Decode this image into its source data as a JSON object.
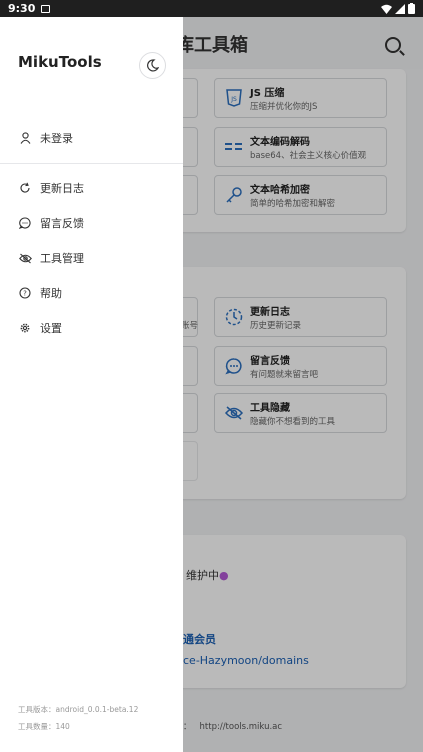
{
  "status": {
    "time": "9:30"
  },
  "drawer": {
    "title": "MikuTools",
    "login_label": "未登录",
    "items": [
      {
        "label": "更新日志",
        "icon": "refresh-icon"
      },
      {
        "label": "留言反馈",
        "icon": "chat-icon"
      },
      {
        "label": "工具管理",
        "icon": "eye-off-icon"
      },
      {
        "label": "帮助",
        "icon": "help-icon"
      },
      {
        "label": "设置",
        "icon": "gear-icon"
      }
    ],
    "footer_version": "工具版本：android_0.0.1-beta.12",
    "footer_count": "工具数量：140"
  },
  "background": {
    "title": "库工具箱",
    "cards_top": [
      {
        "title": "JS 压缩",
        "desc": "压缩并优化你的JS"
      },
      {
        "title": "文本编码解码",
        "desc": "base64、社会主义核心价值观"
      },
      {
        "title": "文本哈希加密",
        "desc": "简单的哈希加密和解密"
      }
    ],
    "cards_mid": [
      {
        "title": "更新日志",
        "desc": "历史更新记录"
      },
      {
        "title": "留言反馈",
        "desc": "有问题就来留言吧"
      },
      {
        "title": "工具隐藏",
        "desc": "隐藏你不想看到的工具"
      }
    ],
    "partial_text": "账号",
    "maintain": "维护中",
    "member": "通会员",
    "domains": "ce-Hazymoon/domains",
    "url_label": "：",
    "url": "http://tools.miku.ac"
  },
  "colors": {
    "accent": "#2b6fbf",
    "dot": "#b45ad6"
  }
}
